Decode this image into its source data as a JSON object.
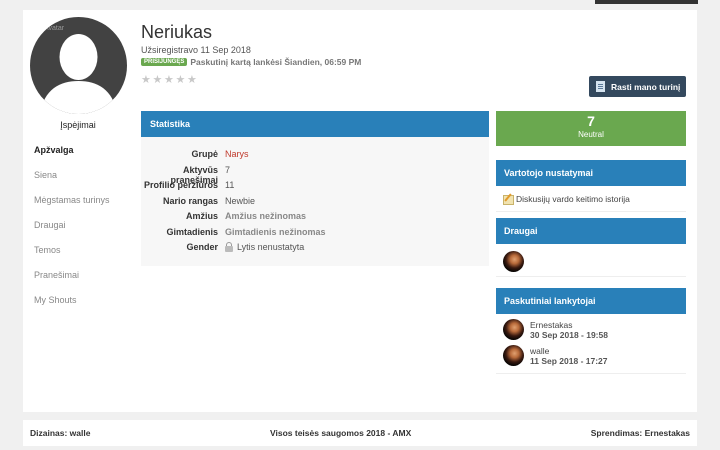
{
  "profile": {
    "name": "Neriukas",
    "registered": "Užsiregistravo 11 Sep 2018",
    "online_badge": "PRISIJUNGĘS",
    "last_visit": "Paskutinį kartą lankėsi Šiandien, 06:59 PM",
    "avatar_label": "Avatar",
    "rating_stars": 5,
    "rating_value": 0
  },
  "actions": {
    "find_content": "Rasti mano turinį"
  },
  "sidebar": {
    "warnings": "Įspėjimai",
    "items": [
      {
        "label": "Apžvalga",
        "active": true
      },
      {
        "label": "Siena"
      },
      {
        "label": "Mėgstamas turinys"
      },
      {
        "label": "Draugai"
      },
      {
        "label": "Temos"
      },
      {
        "label": "Pranešimai"
      },
      {
        "label": "My Shouts"
      }
    ]
  },
  "stats": {
    "title": "Statistika",
    "rows": [
      {
        "key": "Grupė",
        "value": "Narys"
      },
      {
        "key": "Aktyvūs pranešimai",
        "value": "7"
      },
      {
        "key": "Profilio peržiūros",
        "value": "11"
      },
      {
        "key": "Nario rangas",
        "value": "Newbie"
      },
      {
        "key": "Amžius",
        "value": "Amžius nežinomas"
      },
      {
        "key": "Gimtadienis",
        "value": "Gimtadienis nežinomas"
      },
      {
        "key": "Gender",
        "value": "Lytis nenustatyta"
      }
    ]
  },
  "reputation": {
    "value": "7",
    "label": "Neutral"
  },
  "user_settings": {
    "title": "Vartotojo nustatymai",
    "link": "Diskusijų vardo keitimo istorija"
  },
  "friends": {
    "title": "Draugai"
  },
  "visitors": {
    "title": "Paskutiniai lankytojai",
    "items": [
      {
        "name": "Ernestakas",
        "date": "30 Sep 2018 - 19:58"
      },
      {
        "name": "walle",
        "date": "11 Sep 2018 - 17:27"
      }
    ]
  },
  "footer": {
    "left": "Dizainas: walle",
    "center": "Visos teisės saugomos 2018 - AMX",
    "right": "Sprendimas: Ernestakas"
  },
  "colors": {
    "accent_blue": "#2980b9",
    "reputation_green": "#6aa84f",
    "button_dark": "#34495e",
    "group_red": "#c0392b"
  }
}
